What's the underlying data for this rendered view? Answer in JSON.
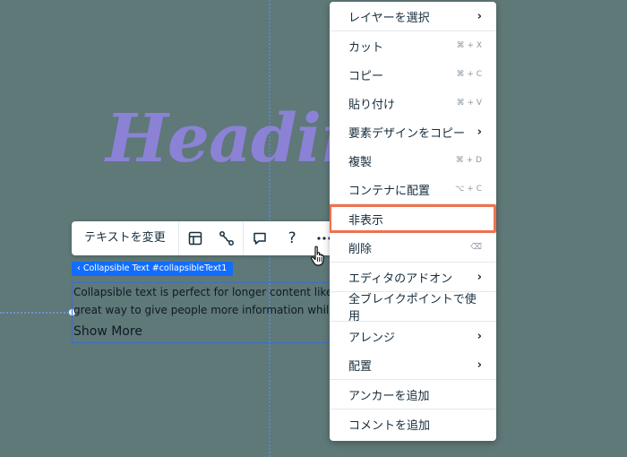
{
  "heading": {
    "text": "Heading"
  },
  "toolbar": {
    "change_text_label": "テキストを変更",
    "help_label": "?"
  },
  "breadcrumb": {
    "text": "‹  Collapsible Text #collapsibleText1"
  },
  "text_box": {
    "line1": "Collapsible text is perfect for longer content like paragraphs and descriptions. It's a",
    "line2": "great way to give people more information while keeping your layout clean.",
    "show_more": "Show More"
  },
  "context_menu": {
    "items": [
      {
        "label": "レイヤーを選択",
        "shortcut": "",
        "submenu": true
      },
      {
        "label": "カット",
        "shortcut": "⌘ + X",
        "submenu": false
      },
      {
        "label": "コピー",
        "shortcut": "⌘ + C",
        "submenu": false
      },
      {
        "label": "貼り付け",
        "shortcut": "⌘ + V",
        "submenu": false
      },
      {
        "label": "要素デザインをコピー",
        "shortcut": "",
        "submenu": true
      },
      {
        "label": "複製",
        "shortcut": "⌘ + D",
        "submenu": false
      },
      {
        "label": "コンテナに配置",
        "shortcut": "⌥ + C",
        "submenu": false
      },
      {
        "label": "非表示",
        "shortcut": "",
        "submenu": false,
        "highlighted": true
      },
      {
        "label": "削除",
        "shortcut": "⌫",
        "submenu": false
      },
      {
        "label": "エディタのアドオン",
        "shortcut": "",
        "submenu": true
      },
      {
        "label": "全ブレイクポイントで使用",
        "shortcut": "",
        "submenu": false
      },
      {
        "label": "アレンジ",
        "shortcut": "",
        "submenu": true
      },
      {
        "label": "配置",
        "shortcut": "",
        "submenu": true
      },
      {
        "label": "アンカーを追加",
        "shortcut": "",
        "submenu": false
      },
      {
        "label": "コメントを追加",
        "shortcut": "",
        "submenu": false
      }
    ],
    "chevron": "›"
  },
  "colors": {
    "canvas": "#5f7878",
    "heading": "#8b82d6",
    "selection_blue": "#116dff",
    "highlight": "#f0714d"
  }
}
